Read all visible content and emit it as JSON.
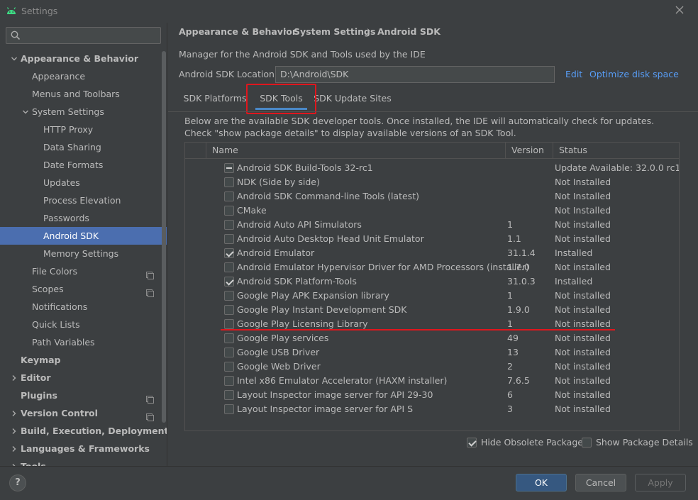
{
  "window": {
    "title": "Settings"
  },
  "search": {
    "placeholder": "",
    "value": ""
  },
  "sidebar": {
    "items": [
      {
        "label": "Appearance & Behavior",
        "bold": true,
        "chevron": "down",
        "indent": 0
      },
      {
        "label": "Appearance",
        "indent": 2
      },
      {
        "label": "Menus and Toolbars",
        "indent": 2
      },
      {
        "label": "System Settings",
        "chevron": "down",
        "indent": 2
      },
      {
        "label": "HTTP Proxy",
        "indent": 3
      },
      {
        "label": "Data Sharing",
        "indent": 3
      },
      {
        "label": "Date Formats",
        "indent": 3
      },
      {
        "label": "Updates",
        "indent": 3
      },
      {
        "label": "Process Elevation",
        "indent": 3
      },
      {
        "label": "Passwords",
        "indent": 3
      },
      {
        "label": "Android SDK",
        "indent": 3,
        "selected": true
      },
      {
        "label": "Memory Settings",
        "indent": 3
      },
      {
        "label": "File Colors",
        "indent": 2,
        "scope": true
      },
      {
        "label": "Scopes",
        "indent": 2,
        "scope": true
      },
      {
        "label": "Notifications",
        "indent": 2
      },
      {
        "label": "Quick Lists",
        "indent": 2
      },
      {
        "label": "Path Variables",
        "indent": 2
      },
      {
        "label": "Keymap",
        "bold": true,
        "indent": 0
      },
      {
        "label": "Editor",
        "bold": true,
        "chevron": "right",
        "indent": 0
      },
      {
        "label": "Plugins",
        "bold": true,
        "indent": 0,
        "scope": true
      },
      {
        "label": "Version Control",
        "bold": true,
        "chevron": "right",
        "indent": 0,
        "scope": true
      },
      {
        "label": "Build, Execution, Deployment",
        "bold": true,
        "chevron": "right",
        "indent": 0
      },
      {
        "label": "Languages & Frameworks",
        "bold": true,
        "chevron": "right",
        "indent": 0
      },
      {
        "label": "Tools",
        "bold": true,
        "chevron": "right",
        "indent": 0
      }
    ]
  },
  "breadcrumb": [
    "Appearance & Behavior",
    "System Settings",
    "Android SDK"
  ],
  "main": {
    "description": "Manager for the Android SDK and Tools used by the IDE",
    "location_label": "Android SDK Location:",
    "location_value": "D:\\Android\\SDK",
    "edit_link": "Edit",
    "optimize_link": "Optimize disk space",
    "tabs": [
      {
        "label": "SDK Platforms"
      },
      {
        "label": "SDK Tools",
        "active": true
      },
      {
        "label": "SDK Update Sites"
      }
    ],
    "info_lines": [
      "Below are the available SDK developer tools. Once installed, the IDE will automatically check for updates.",
      "Check \"show package details\" to display available versions of an SDK Tool."
    ],
    "table": {
      "columns": [
        "Name",
        "Version",
        "Status"
      ],
      "rows": [
        {
          "name": "Android SDK Build-Tools 32-rc1",
          "version": "",
          "status": "Update Available: 32.0.0 rc1",
          "check": "partial"
        },
        {
          "name": "NDK (Side by side)",
          "version": "",
          "status": "Not Installed",
          "check": "none"
        },
        {
          "name": "Android SDK Command-line Tools (latest)",
          "version": "",
          "status": "Not Installed",
          "check": "none"
        },
        {
          "name": "CMake",
          "version": "",
          "status": "Not Installed",
          "check": "none"
        },
        {
          "name": "Android Auto API Simulators",
          "version": "1",
          "status": "Not installed",
          "check": "none"
        },
        {
          "name": "Android Auto Desktop Head Unit Emulator",
          "version": "1.1",
          "status": "Not installed",
          "check": "none"
        },
        {
          "name": "Android Emulator",
          "version": "31.1.4",
          "status": "Installed",
          "check": "checked"
        },
        {
          "name": "Android Emulator Hypervisor Driver for AMD Processors (installer)",
          "version": "1.7.0",
          "status": "Not installed",
          "check": "none"
        },
        {
          "name": "Android SDK Platform-Tools",
          "version": "31.0.3",
          "status": "Installed",
          "check": "checked"
        },
        {
          "name": "Google Play APK Expansion library",
          "version": "1",
          "status": "Not installed",
          "check": "none"
        },
        {
          "name": "Google Play Instant Development SDK",
          "version": "1.9.0",
          "status": "Not installed",
          "check": "none"
        },
        {
          "name": "Google Play Licensing Library",
          "version": "1",
          "status": "Not installed",
          "check": "none"
        },
        {
          "name": "Google Play services",
          "version": "49",
          "status": "Not installed",
          "check": "none"
        },
        {
          "name": "Google USB Driver",
          "version": "13",
          "status": "Not installed",
          "check": "none"
        },
        {
          "name": "Google Web Driver",
          "version": "2",
          "status": "Not installed",
          "check": "none"
        },
        {
          "name": "Intel x86 Emulator Accelerator (HAXM installer)",
          "version": "7.6.5",
          "status": "Not installed",
          "check": "none"
        },
        {
          "name": "Layout Inspector image server for API 29-30",
          "version": "6",
          "status": "Not installed",
          "check": "none"
        },
        {
          "name": "Layout Inspector image server for API S",
          "version": "3",
          "status": "Not installed",
          "check": "none"
        }
      ]
    },
    "hide_obsolete_label": "Hide Obsolete Packages",
    "hide_obsolete_checked": true,
    "show_details_label": "Show Package Details",
    "show_details_checked": false
  },
  "footer": {
    "help_label": "?",
    "ok_label": "OK",
    "cancel_label": "Cancel",
    "apply_label": "Apply"
  },
  "colors": {
    "background": "#3c3f41",
    "selection": "#4b6eaf",
    "link": "#589df6",
    "primary_button": "#365880",
    "annotation_red": "#e0161d",
    "android_green": "#3ddc84"
  }
}
